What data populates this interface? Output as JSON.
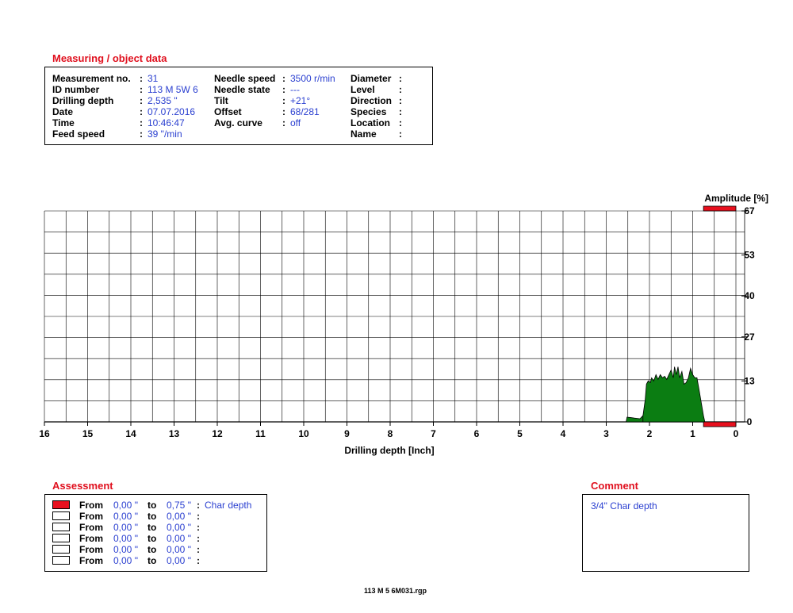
{
  "measuring": {
    "title": "Measuring / object data",
    "col1": [
      {
        "label": "Measurement no.",
        "value": "31"
      },
      {
        "label": "ID number",
        "value": "113 M 5W 6"
      },
      {
        "label": "Drilling depth",
        "value": "2,535 \""
      },
      {
        "label": "Date",
        "value": "07.07.2016"
      },
      {
        "label": "Time",
        "value": "10:46:47"
      },
      {
        "label": "Feed speed",
        "value": "39 \"/min"
      }
    ],
    "col2": [
      {
        "label": "Needle speed",
        "value": "3500 r/min"
      },
      {
        "label": "Needle state",
        "value": "---"
      },
      {
        "label": "Tilt",
        "value": "+21°"
      },
      {
        "label": "Offset",
        "value": "68/281"
      },
      {
        "label": "Avg. curve",
        "value": "off"
      }
    ],
    "col3": [
      {
        "label": "Diameter",
        "value": ""
      },
      {
        "label": "Level",
        "value": ""
      },
      {
        "label": "Direction",
        "value": ""
      },
      {
        "label": "Species",
        "value": ""
      },
      {
        "label": "Location",
        "value": ""
      },
      {
        "label": "Name",
        "value": ""
      }
    ]
  },
  "chart_data": {
    "type": "area",
    "xlabel": "Drilling depth [Inch]",
    "ylabel": "Amplitude [%]",
    "xlim": [
      16,
      0
    ],
    "ylim": [
      0,
      67
    ],
    "x_ticks": [
      "16",
      "15",
      "14",
      "13",
      "12",
      "11",
      "10",
      "9",
      "8",
      "7",
      "6",
      "5",
      "4",
      "3",
      "2",
      "1",
      "0"
    ],
    "y_ticks": [
      "67",
      "53",
      "40",
      "27",
      "13",
      "0"
    ],
    "grid": true,
    "reversed_x": true,
    "fill_color": "#0b7d12",
    "marker_color": "#e8101e",
    "trace_start": [
      {
        "x": 2.54,
        "y": 0
      },
      {
        "x": 2.52,
        "y": 1.5
      },
      {
        "x": 2.45,
        "y": 1.4
      },
      {
        "x": 2.35,
        "y": 1.2
      },
      {
        "x": 2.22,
        "y": 1.0
      },
      {
        "x": 2.15,
        "y": 2
      }
    ],
    "series": [
      {
        "values": [
          {
            "x": 2.15,
            "y": 2
          },
          {
            "x": 2.1,
            "y": 7
          },
          {
            "x": 2.07,
            "y": 12
          },
          {
            "x": 2.03,
            "y": 13
          },
          {
            "x": 1.98,
            "y": 12.5
          },
          {
            "x": 1.95,
            "y": 14
          },
          {
            "x": 1.9,
            "y": 13
          },
          {
            "x": 1.85,
            "y": 15
          },
          {
            "x": 1.8,
            "y": 13.5
          },
          {
            "x": 1.75,
            "y": 15
          },
          {
            "x": 1.7,
            "y": 14
          },
          {
            "x": 1.65,
            "y": 14.5
          },
          {
            "x": 1.6,
            "y": 13.5
          },
          {
            "x": 1.55,
            "y": 15
          },
          {
            "x": 1.5,
            "y": 16.5
          },
          {
            "x": 1.45,
            "y": 14
          },
          {
            "x": 1.42,
            "y": 17.5
          },
          {
            "x": 1.38,
            "y": 15
          },
          {
            "x": 1.34,
            "y": 17.5
          },
          {
            "x": 1.3,
            "y": 14
          },
          {
            "x": 1.25,
            "y": 16
          },
          {
            "x": 1.2,
            "y": 12
          },
          {
            "x": 1.15,
            "y": 12.5
          },
          {
            "x": 1.1,
            "y": 14
          },
          {
            "x": 1.05,
            "y": 17
          },
          {
            "x": 1.0,
            "y": 15
          },
          {
            "x": 0.95,
            "y": 14
          },
          {
            "x": 0.9,
            "y": 14
          },
          {
            "x": 0.85,
            "y": 10
          },
          {
            "x": 0.8,
            "y": 6
          },
          {
            "x": 0.75,
            "y": 2
          },
          {
            "x": 0.72,
            "y": 0
          }
        ]
      }
    ],
    "markers": {
      "top": {
        "x_from": 0.75,
        "x_to": 0,
        "y": 67
      },
      "bottom": {
        "x_from": 0.75,
        "x_to": 0,
        "y": 0
      }
    }
  },
  "assessment": {
    "title": "Assessment",
    "rows": [
      {
        "color": "#e8101e",
        "from_label": "From",
        "from": "0,00 \"",
        "to_label": "to",
        "to": "0,75 \"",
        "note": "Char depth"
      },
      {
        "color": "#ffffff",
        "from_label": "From",
        "from": "0,00 \"",
        "to_label": "to",
        "to": "0,00 \"",
        "note": ""
      },
      {
        "color": "#ffffff",
        "from_label": "From",
        "from": "0,00 \"",
        "to_label": "to",
        "to": "0,00 \"",
        "note": ""
      },
      {
        "color": "#ffffff",
        "from_label": "From",
        "from": "0,00 \"",
        "to_label": "to",
        "to": "0,00 \"",
        "note": ""
      },
      {
        "color": "#ffffff",
        "from_label": "From",
        "from": "0,00 \"",
        "to_label": "to",
        "to": "0,00 \"",
        "note": ""
      },
      {
        "color": "#ffffff",
        "from_label": "From",
        "from": "0,00 \"",
        "to_label": "to",
        "to": "0,00 \"",
        "note": ""
      }
    ]
  },
  "comment": {
    "title": "Comment",
    "text": "3/4\" Char depth"
  },
  "footer": {
    "filename": "113 M 5 6M031.rgp"
  }
}
